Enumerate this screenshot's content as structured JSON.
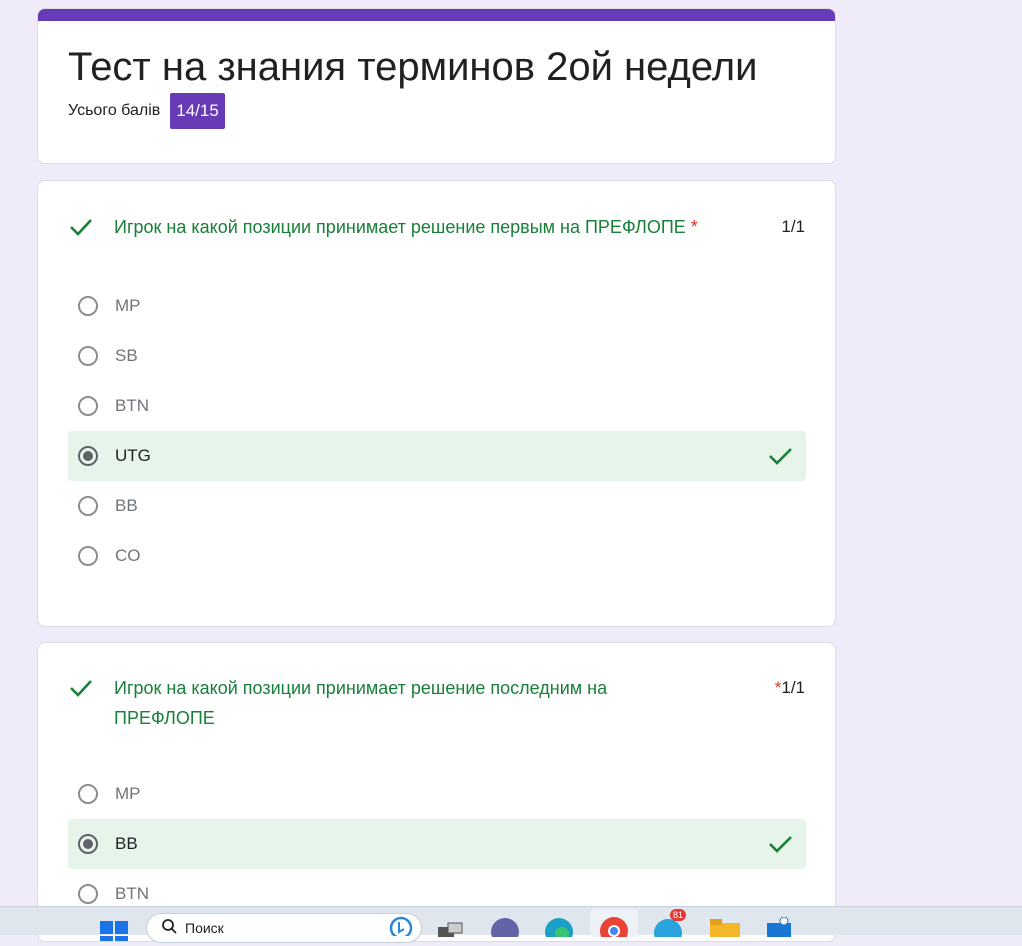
{
  "header": {
    "title": "Тест на знания терминов 2ой недели",
    "score_label": "Усього балів",
    "score_value": "14/15"
  },
  "questions": [
    {
      "text": "Игрок на какой позиции принимает решение первым на ПРЕФЛОПЕ",
      "required_mark": "*",
      "points": "1/1",
      "options": [
        {
          "label": "MP",
          "selected": false
        },
        {
          "label": "SB",
          "selected": false
        },
        {
          "label": "BTN",
          "selected": false
        },
        {
          "label": "UTG",
          "selected": true
        },
        {
          "label": "BB",
          "selected": false
        },
        {
          "label": "CO",
          "selected": false
        }
      ]
    },
    {
      "text_line1": "Игрок на какой позиции принимает решение последним на",
      "text_line2": "ПРЕФЛОПЕ",
      "required_mark": "*",
      "points": "1/1",
      "options": [
        {
          "label": "MP",
          "selected": false
        },
        {
          "label": "BB",
          "selected": true
        },
        {
          "label": "BTN",
          "selected": false
        }
      ]
    }
  ],
  "taskbar": {
    "search_placeholder": "Поиск",
    "telegram_badge": "81",
    "icons": [
      "windows-start-icon",
      "search-icon",
      "bing-icon",
      "task-view-icon",
      "teams-icon",
      "edge-icon",
      "chrome-icon",
      "telegram-icon",
      "file-explorer-icon",
      "store-icon"
    ]
  },
  "colors": {
    "accent": "#673ab7",
    "correct": "#188038",
    "correct_bg": "#e6f4ea",
    "required": "#d93025",
    "page_bg": "#efebf8"
  }
}
